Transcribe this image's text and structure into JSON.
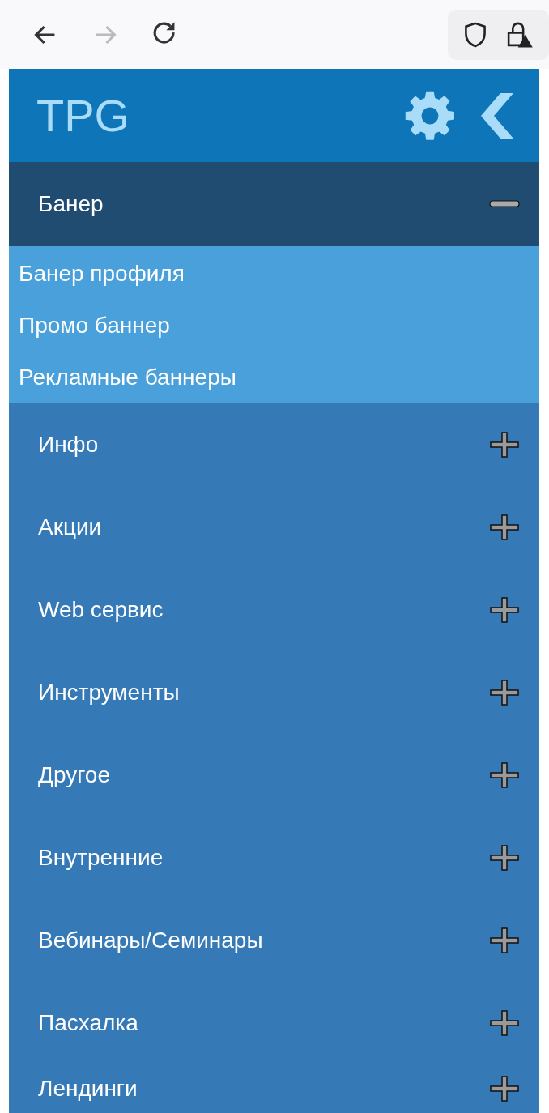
{
  "browser_toolbar": {
    "nav_buttons": [
      {
        "kind": "back",
        "disabled": false
      },
      {
        "kind": "forward",
        "disabled": true
      },
      {
        "kind": "reload",
        "disabled": false
      }
    ]
  },
  "sidebar": {
    "title": "TPG",
    "menu": [
      {
        "label": "Банер",
        "expanded": true,
        "children": [
          {
            "label": "Банер профиля"
          },
          {
            "label": "Промо баннер"
          },
          {
            "label": "Рекламные баннеры"
          }
        ]
      },
      {
        "label": "Инфо",
        "expanded": false
      },
      {
        "label": "Акции",
        "expanded": false
      },
      {
        "label": "Web сервис",
        "expanded": false
      },
      {
        "label": "Инструменты",
        "expanded": false
      },
      {
        "label": "Другое",
        "expanded": false
      },
      {
        "label": "Внутренние",
        "expanded": false
      },
      {
        "label": "Вебинары/Семинары",
        "expanded": false
      },
      {
        "label": "Пасхалка",
        "expanded": false
      },
      {
        "label": "Лендинги",
        "expanded": false
      }
    ]
  }
}
